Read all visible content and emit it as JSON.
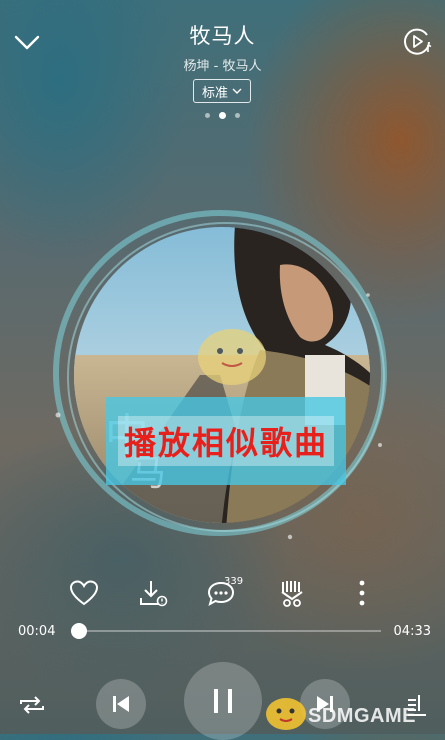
{
  "header": {
    "title": "牧马人",
    "subtitle": "杨坤 - 牧马人",
    "quality_label": "标准",
    "page_dots": 3,
    "active_dot": 1
  },
  "album_art": {
    "banner_text": "播放相似歌曲"
  },
  "actions": {
    "like": "heart-icon",
    "download": "download-icon",
    "comment": "comment-icon",
    "comment_count": "339",
    "share": "share-icon",
    "more": "more-icon"
  },
  "progress": {
    "current_time": "00:04",
    "total_time": "04:33",
    "fraction": 0.015
  },
  "controls": {
    "repeat": "repeat-icon",
    "previous": "previous-icon",
    "play_pause": "pause-icon",
    "next": "next-icon",
    "playlist": "playlist-icon"
  },
  "watermark": {
    "text": "SDMGAME"
  },
  "colors": {
    "banner_bg": "#46c8e6",
    "banner_text": "#e8201c",
    "ring": "#7fd6df"
  }
}
